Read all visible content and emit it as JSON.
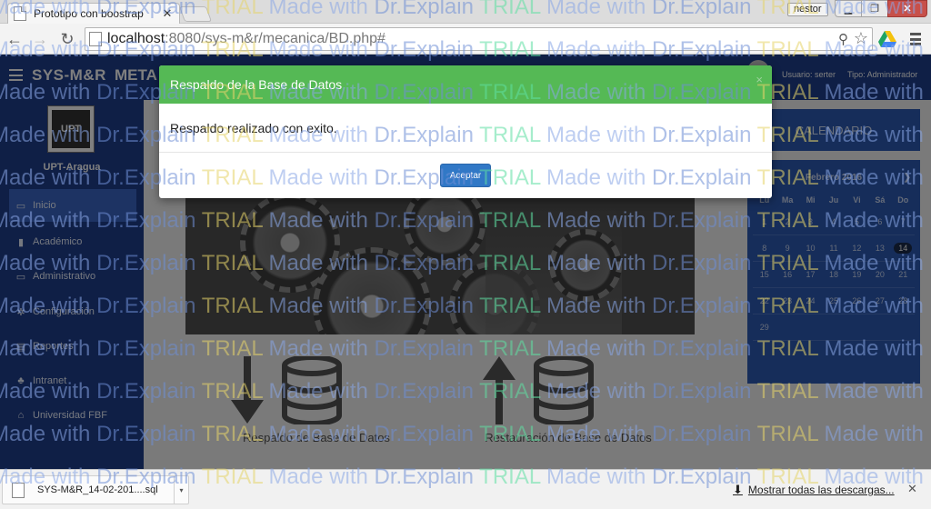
{
  "browser": {
    "tab_title": "Prototipo con boostrap",
    "tab_close": "✕",
    "profile": "nestor",
    "url_host": "localhost",
    "url_path": ":8080/sys-m&r/mecanica/BD.php#"
  },
  "app": {
    "brand": "SYS-M&R",
    "brand_meta": "META",
    "user_label": "Usuario: serter",
    "type_label": "Tipo: Administrador",
    "logo_text": "UPT",
    "institution": "UPT-Aragua"
  },
  "sidebar": {
    "items": [
      {
        "label": "Inicio",
        "icon": "folder-open-icon",
        "glyph": "▭"
      },
      {
        "label": "Académico",
        "icon": "book-icon",
        "glyph": "▮"
      },
      {
        "label": "Administrativo",
        "icon": "monitor-icon",
        "glyph": "▭"
      },
      {
        "label": "Configuración",
        "icon": "cogs-icon",
        "glyph": "✲"
      },
      {
        "label": "Reportes",
        "icon": "document-icon",
        "glyph": "▤"
      },
      {
        "label": "Intranet",
        "icon": "sitemap-icon",
        "glyph": "♣"
      },
      {
        "label": "Universidad FBF",
        "icon": "institution-icon",
        "glyph": "⌂"
      }
    ]
  },
  "main": {
    "backup_label": "Respaldo de Base de Datos",
    "restore_label": "Restauración de Base de Datos"
  },
  "calendar": {
    "header": "CALENDARIO",
    "month": "Febrero 2016",
    "prev": "❮",
    "next": "❯",
    "weekdays": [
      "Lu",
      "Ma",
      "Mi",
      "Ju",
      "Vi",
      "Sá",
      "Do"
    ],
    "weeks": [
      [
        "1",
        "2",
        "3",
        "4",
        "5",
        "6",
        "7"
      ],
      [
        "8",
        "9",
        "10",
        "11",
        "12",
        "13",
        "14"
      ],
      [
        "15",
        "16",
        "17",
        "18",
        "19",
        "20",
        "21"
      ],
      [
        "22",
        "23",
        "24",
        "25",
        "26",
        "27",
        "28"
      ],
      [
        "29",
        "",
        "",
        "",
        "",
        "",
        ""
      ]
    ],
    "today": "14"
  },
  "modal": {
    "title": "Respaldo de la Base de Datos",
    "close": "×",
    "body": "Respaldo realizado con exito.",
    "accept": "Aceptar"
  },
  "watermark": {
    "made": "Made with ",
    "explain": "Dr.Explain ",
    "trial": "TRIAL "
  },
  "downloads": {
    "file": "SYS-M&R_14-02-201....sql",
    "show_all": "Mostrar todas las descargas...",
    "close": "✕"
  },
  "colors": {
    "header": "#1e3e8c",
    "modal_header": "#55b955",
    "accept_button": "#3178c6"
  }
}
